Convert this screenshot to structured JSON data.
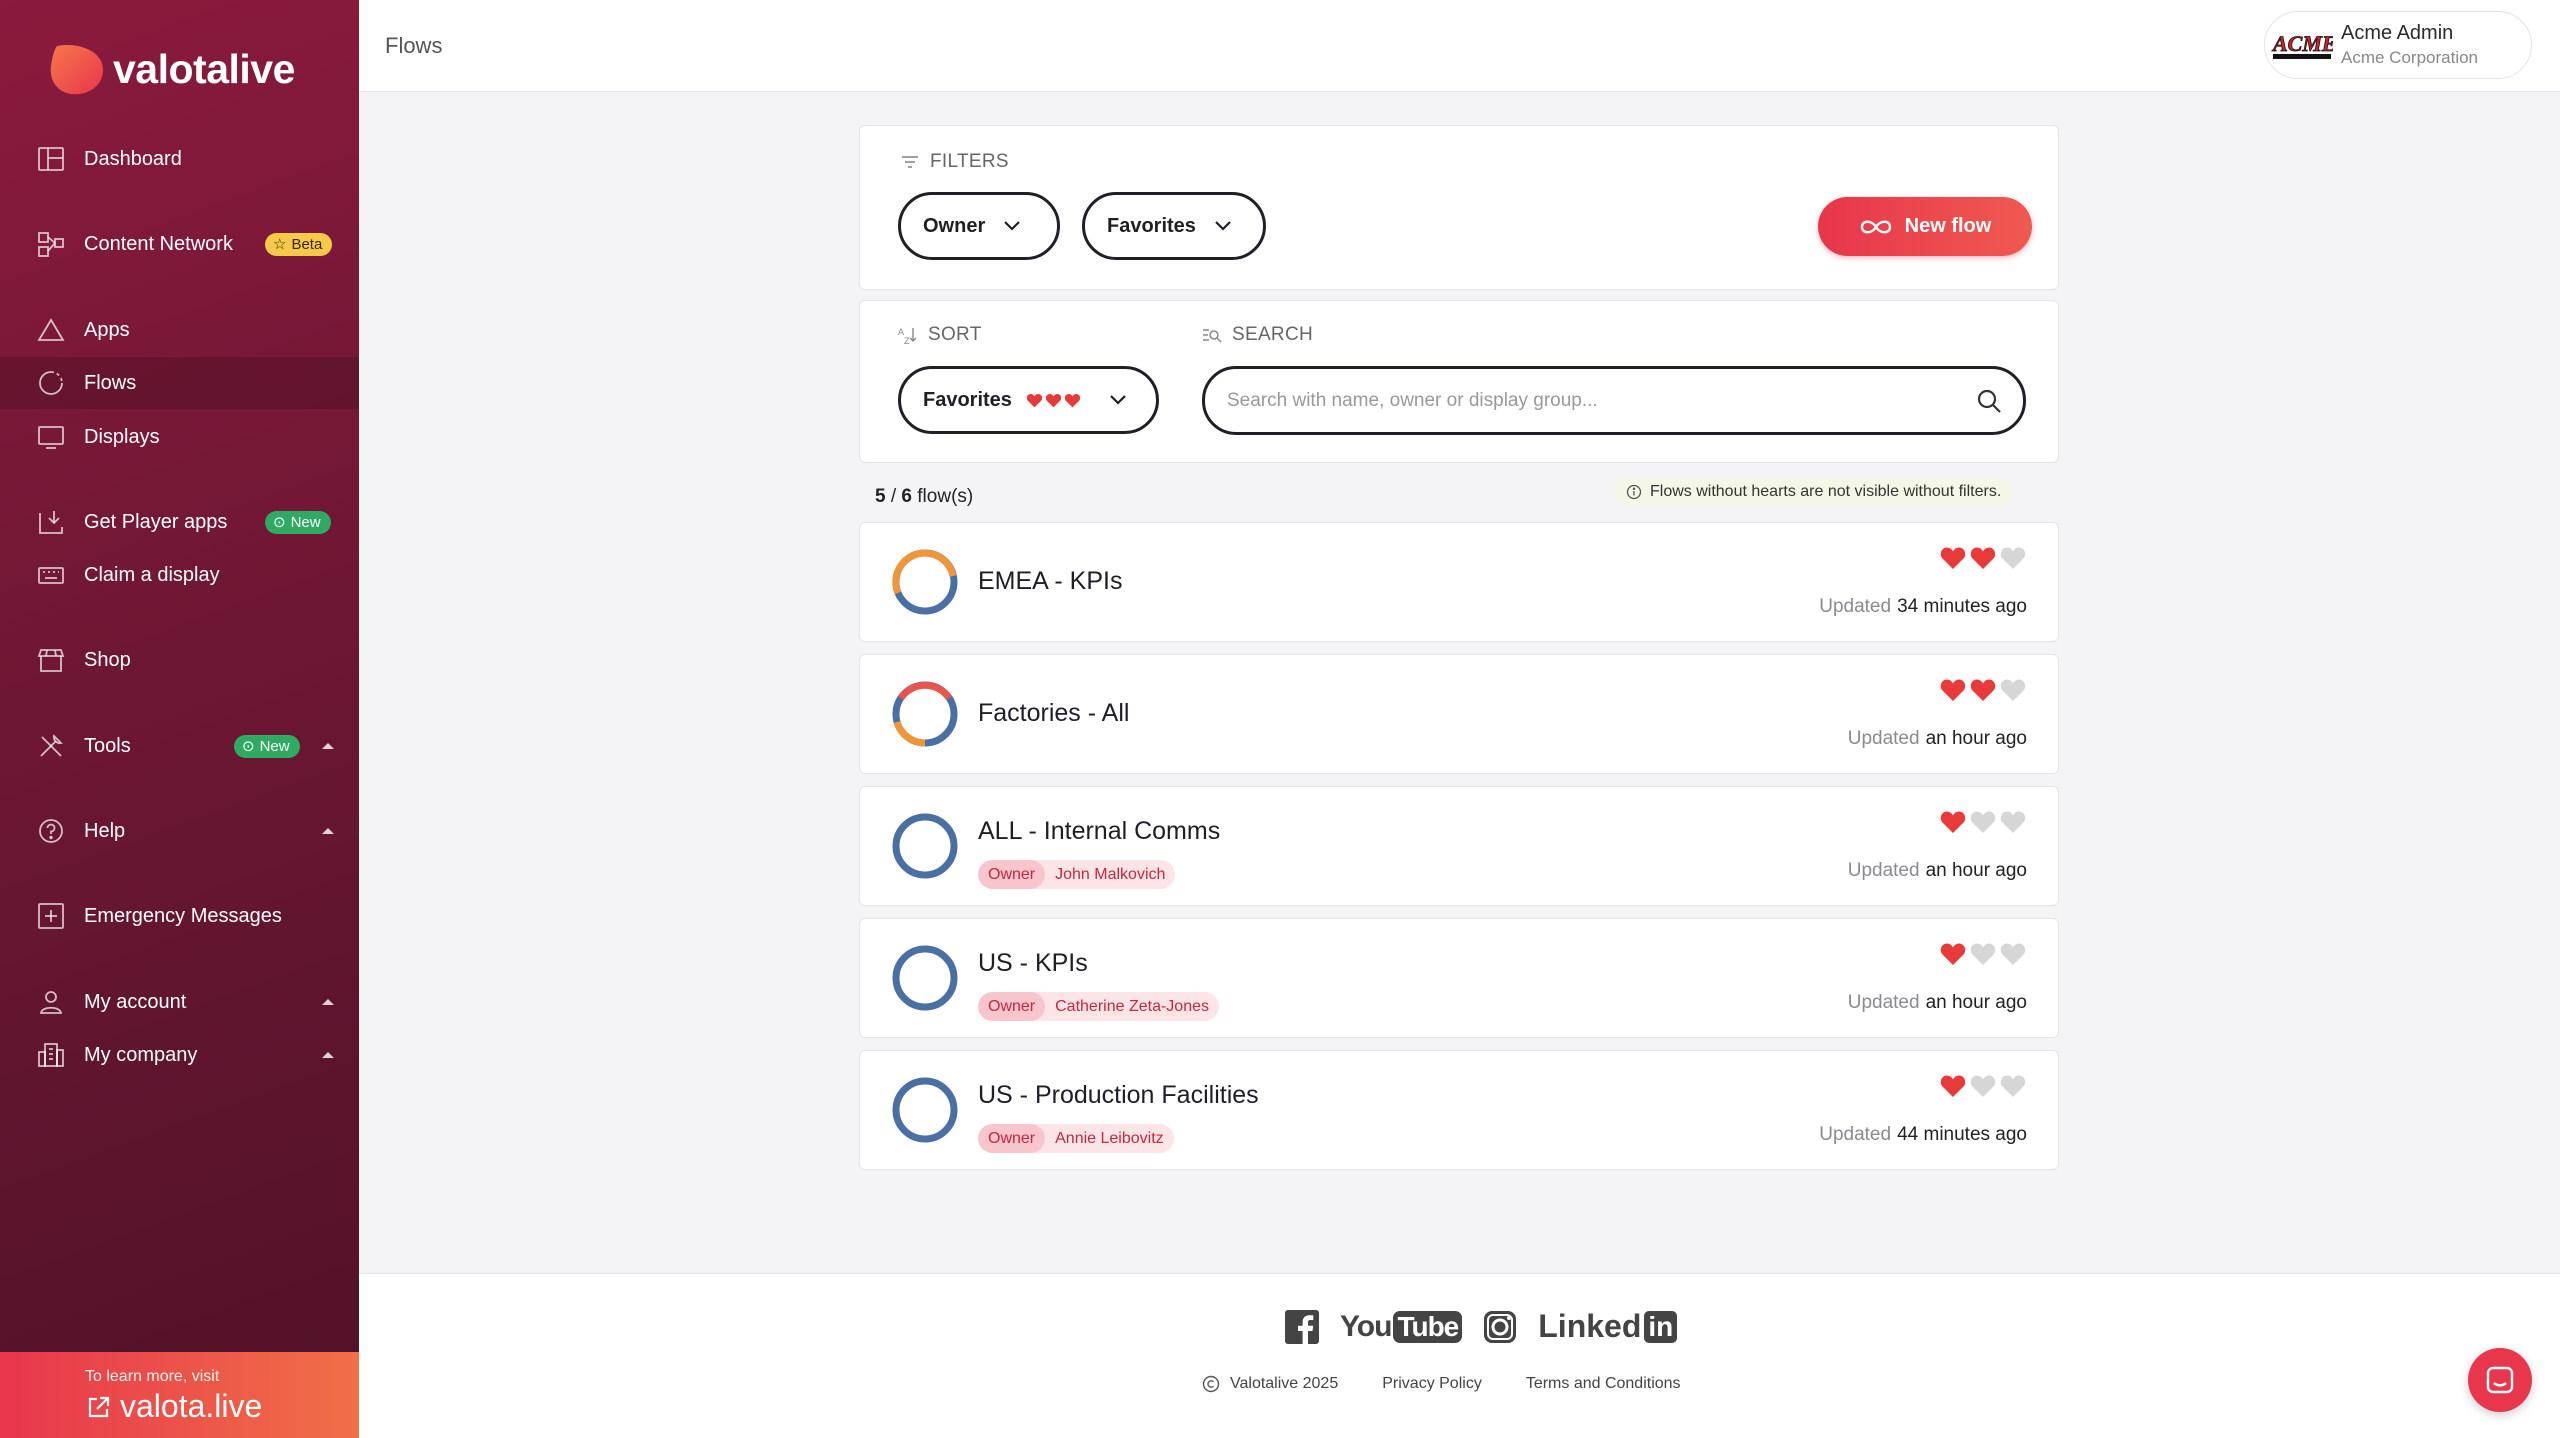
{
  "app": {
    "brand": "valotalive",
    "page_title": "Flows"
  },
  "colors": {
    "sidebar": "#6e1734",
    "accent": "#e8364c",
    "beta": "#f7c948",
    "new": "#2eaa63",
    "ring_blue": "#4a6fa5",
    "ring_orange": "#f0953a",
    "heart_on": "#e83a3a",
    "heart_off": "#d6d6d6"
  },
  "sidebar": {
    "items": [
      {
        "label": "Dashboard",
        "icon": "dashboard-icon"
      },
      {
        "label": "Content Network",
        "icon": "content-network-icon",
        "badge": "Beta"
      },
      {
        "label": "Apps",
        "icon": "apps-icon"
      },
      {
        "label": "Flows",
        "icon": "flows-icon",
        "active": true
      },
      {
        "label": "Displays",
        "icon": "displays-icon"
      },
      {
        "label": "Get Player apps",
        "icon": "download-icon",
        "badge": "New"
      },
      {
        "label": "Claim a display",
        "icon": "keyboard-icon"
      },
      {
        "label": "Shop",
        "icon": "shop-icon"
      },
      {
        "label": "Tools",
        "icon": "tools-icon",
        "badge": "New"
      },
      {
        "label": "Help",
        "icon": "help-icon"
      },
      {
        "label": "Emergency Messages",
        "icon": "emergency-icon"
      },
      {
        "label": "My account",
        "icon": "account-icon"
      },
      {
        "label": "My company",
        "icon": "company-icon"
      }
    ],
    "learn_small": "To learn more, visit",
    "learn_link": "valota.live"
  },
  "user": {
    "name": "Acme Admin",
    "company": "Acme Corporation",
    "logo_text": "ACME"
  },
  "filters": {
    "label": "FILTERS",
    "owner_label": "Owner",
    "favorites_label": "Favorites",
    "new_flow_label": "New flow"
  },
  "sort": {
    "label": "SORT",
    "value": "Favorites"
  },
  "search": {
    "label": "SEARCH",
    "placeholder": "Search with name, owner or display group..."
  },
  "count": {
    "shown": "5",
    "total": "6",
    "suffix": "flow(s)"
  },
  "notice": "Flows without hearts are not visible without filters.",
  "flows": [
    {
      "name": "EMEA - KPIs",
      "hearts": 2,
      "updated_label": "Updated",
      "updated": "34 minutes ago",
      "owner_label": "",
      "owner": ""
    },
    {
      "name": "Factories - All",
      "hearts": 2,
      "updated_label": "Updated",
      "updated": "an hour ago",
      "owner_label": "",
      "owner": ""
    },
    {
      "name": "ALL - Internal Comms",
      "hearts": 1,
      "updated_label": "Updated",
      "updated": "an hour ago",
      "owner_label": "Owner",
      "owner": "John Malkovich"
    },
    {
      "name": "US - KPIs",
      "hearts": 1,
      "updated_label": "Updated",
      "updated": "an hour ago",
      "owner_label": "Owner",
      "owner": "Catherine Zeta-Jones"
    },
    {
      "name": "US - Production Facilities",
      "hearts": 1,
      "updated_label": "Updated",
      "updated": "44 minutes ago",
      "owner_label": "Owner",
      "owner": "Annie Leibovitz"
    }
  ],
  "footer": {
    "copyright": "Valotalive 2025",
    "privacy": "Privacy Policy",
    "terms": "Terms and Conditions",
    "socials": [
      "facebook-icon",
      "youtube-icon",
      "instagram-icon",
      "linkedin-icon"
    ],
    "youtube_you": "You",
    "youtube_tube": "Tube",
    "linkedin_linked": "Linked",
    "linkedin_in": "in"
  }
}
